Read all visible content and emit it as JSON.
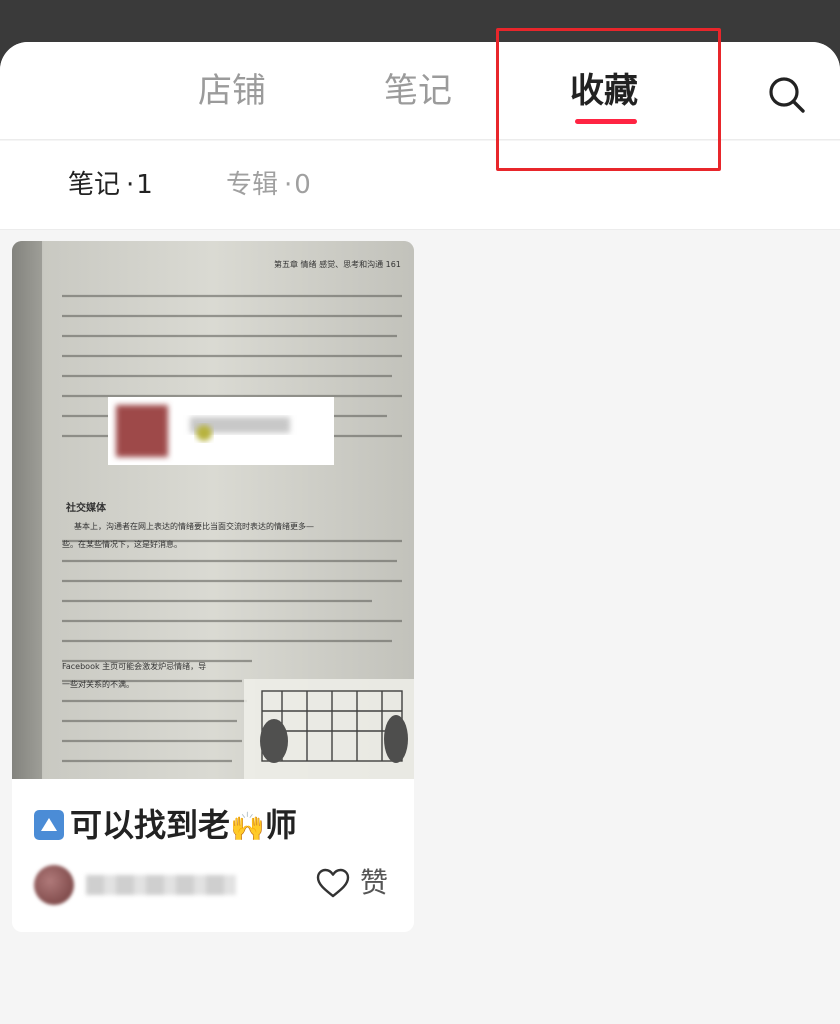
{
  "tabs": [
    {
      "label": "店铺"
    },
    {
      "label": "笔记"
    },
    {
      "label": "收藏"
    }
  ],
  "active_tab": "收藏",
  "sub_tabs": [
    {
      "label": "笔记",
      "dot": "·",
      "count": "1"
    },
    {
      "label": "专辑",
      "dot": "·",
      "count": "0"
    }
  ],
  "note": {
    "title_text": "可以找到老",
    "title_text_tail": "师",
    "emoji_hands": "🙌",
    "author": "",
    "like_label": "赞"
  },
  "cover_page_text": {
    "header": "第五章  情绪 感觉、思考和沟通  161",
    "heading": "社交媒体",
    "line1": "基本上，沟通者在网上表达的情绪要比当面交流时表达的情绪更多—",
    "line2": "些。在某些情况下，这是好消息。",
    "line3": "Facebook 主页可能会激发炉忌情绪，导",
    "line4": "一些对关系的不满。"
  },
  "colors": {
    "accent": "#ff2442",
    "highlight_box": "#e8262b",
    "active_text": "#222222",
    "inactive_text": "#9b9b9b"
  },
  "icons": {
    "search": "search-icon",
    "like": "heart-outline-icon",
    "title_prefix": "up-triangle-button-icon"
  }
}
